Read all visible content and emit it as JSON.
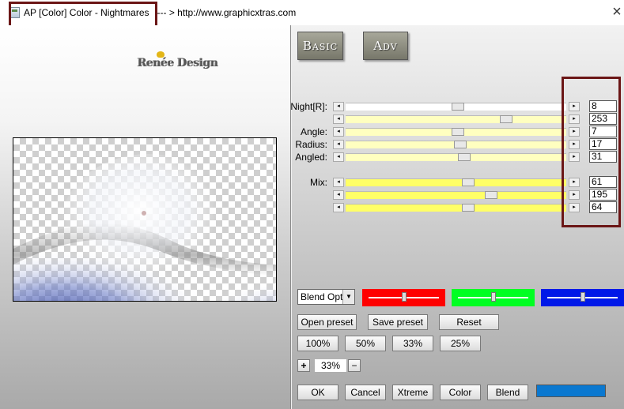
{
  "window": {
    "title": "AP [Color]  Color - Nightmares",
    "url_text": "--- > http://www.graphicxtras.com",
    "close_glyph": "×"
  },
  "logo": {
    "text": "Renée Design"
  },
  "tabs": [
    {
      "label": "Basic"
    },
    {
      "label": "Adv"
    }
  ],
  "colors": {
    "highlight_box": "#6b1616",
    "slider_white": "#ffffff",
    "slider_pale_yellow": "#ffffc0",
    "slider_yellow": "#ffff66",
    "red": "#ff0000",
    "green": "#00ff22",
    "blue": "#0018e8",
    "swatch": "#0a78d0"
  },
  "parameters": [
    {
      "label": "Night[R]:",
      "value": "8",
      "fraction": 0.51
    },
    {
      "label": "",
      "value": "253",
      "fraction": 0.74
    },
    {
      "label": "Angle:",
      "value": "7",
      "fraction": 0.51
    },
    {
      "label": "Radius:",
      "value": "17",
      "fraction": 0.52
    },
    {
      "label": "Angled:",
      "value": "31",
      "fraction": 0.54
    },
    {
      "label": "Mix:",
      "value": "61",
      "fraction": 0.56
    },
    {
      "label": "",
      "value": "195",
      "fraction": 0.67
    },
    {
      "label": "",
      "value": "64",
      "fraction": 0.56
    }
  ],
  "blend": {
    "select_value": "Blend Opti",
    "rgb_levels": {
      "red": 0.5,
      "green": 0.5,
      "blue": 0.5
    }
  },
  "buttons": {
    "open_preset": "Open preset",
    "save_preset": "Save preset",
    "reset": "Reset",
    "zoom_presets": [
      "100%",
      "50%",
      "33%",
      "25%"
    ],
    "zoom_plus": "+",
    "zoom_value": "33%",
    "zoom_minus": "−",
    "ok": "OK",
    "cancel": "Cancel",
    "xtreme": "Xtreme",
    "color": "Color",
    "blend": "Blend"
  }
}
